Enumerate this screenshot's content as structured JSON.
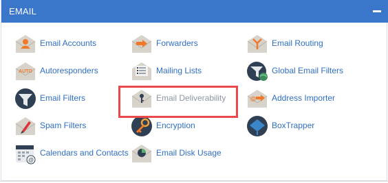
{
  "panel": {
    "title": "EMAIL",
    "collapse_icon": "minus-icon"
  },
  "items": [
    {
      "label": "Email Accounts",
      "icon": "email-accounts-icon"
    },
    {
      "label": "Forwarders",
      "icon": "forwarders-icon"
    },
    {
      "label": "Email Routing",
      "icon": "email-routing-icon"
    },
    {
      "label": "Autoresponders",
      "icon": "autoresponders-icon"
    },
    {
      "label": "Mailing Lists",
      "icon": "mailing-lists-icon"
    },
    {
      "label": "Global Email Filters",
      "icon": "global-email-filters-icon"
    },
    {
      "label": "Email Filters",
      "icon": "email-filters-icon"
    },
    {
      "label": "Email Deliverability",
      "icon": "email-deliverability-icon"
    },
    {
      "label": "Address Importer",
      "icon": "address-importer-icon"
    },
    {
      "label": "Spam Filters",
      "icon": "spam-filters-icon"
    },
    {
      "label": "Encryption",
      "icon": "encryption-icon"
    },
    {
      "label": "BoxTrapper",
      "icon": "boxtrapper-icon"
    },
    {
      "label": "Calendars and Contacts",
      "icon": "calendars-contacts-icon"
    },
    {
      "label": "Email Disk Usage",
      "icon": "email-disk-usage-icon"
    }
  ],
  "icon_text": {
    "auto": "AUTO"
  },
  "colors": {
    "header": "#3a76c9",
    "link": "#2f6fbf",
    "disabled_link": "#8c96a3",
    "highlight": "#e9494b",
    "envelope": "#d7d3cb",
    "orange": "#f0792a",
    "navy": "#2f4054"
  }
}
